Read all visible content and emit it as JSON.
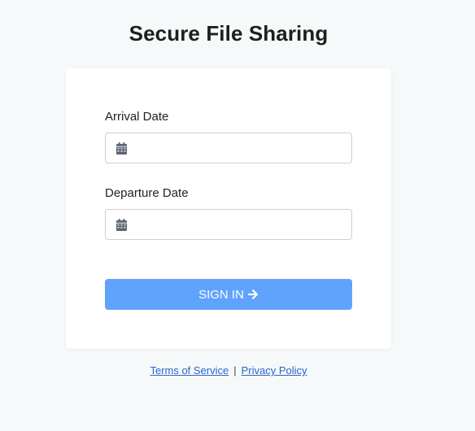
{
  "header": {
    "title": "Secure File Sharing"
  },
  "form": {
    "arrival": {
      "label": "Arrival Date",
      "value": "",
      "icon": "calendar-icon"
    },
    "departure": {
      "label": "Departure Date",
      "value": "",
      "icon": "calendar-icon"
    },
    "submit_label": "SIGN IN",
    "submit_icon": "arrow-right-icon"
  },
  "footer": {
    "terms_label": "Terms of Service",
    "separator": "|",
    "privacy_label": "Privacy Policy"
  },
  "colors": {
    "background": "#f5f9fa",
    "card": "#ffffff",
    "button": "#60a3fd",
    "link": "#2a66c9"
  }
}
